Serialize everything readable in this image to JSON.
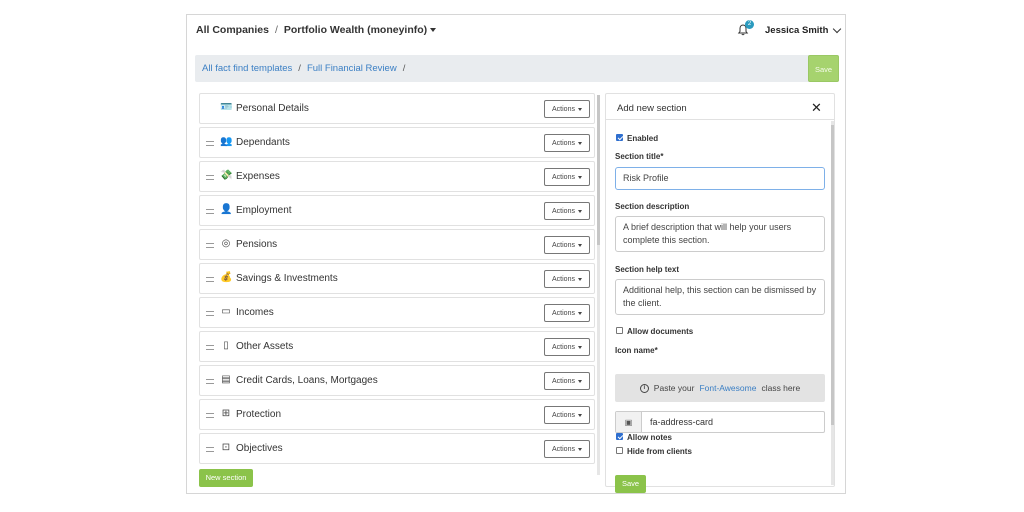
{
  "topbar": {
    "company": "All Companies",
    "separator": "/",
    "portfolio": "Portfolio Wealth (moneyinfo)",
    "notification_count": "2",
    "user_name": "Jessica Smith"
  },
  "breadcrumb": {
    "items": [
      "All fact find templates",
      "Full Financial Review"
    ],
    "separator": "/",
    "save_label": "Save"
  },
  "sections": [
    {
      "label": "Personal Details",
      "icon": "address-card-icon",
      "glyph": "🪪",
      "actions": "Actions"
    },
    {
      "label": "Dependants",
      "icon": "users-icon",
      "glyph": "👥",
      "actions": "Actions"
    },
    {
      "label": "Expenses",
      "icon": "money-bill-icon",
      "glyph": "💸",
      "actions": "Actions"
    },
    {
      "label": "Employment",
      "icon": "user-tie-icon",
      "glyph": "👤",
      "actions": "Actions"
    },
    {
      "label": "Pensions",
      "icon": "coins-icon",
      "glyph": "◎",
      "actions": "Actions"
    },
    {
      "label": "Savings & Investments",
      "icon": "money-bag-icon",
      "glyph": "💰",
      "actions": "Actions"
    },
    {
      "label": "Incomes",
      "icon": "wallet-icon",
      "glyph": "▭",
      "actions": "Actions"
    },
    {
      "label": "Other Assets",
      "icon": "building-icon",
      "glyph": "▯",
      "actions": "Actions"
    },
    {
      "label": "Credit Cards, Loans, Mortgages",
      "icon": "credit-card-icon",
      "glyph": "▤",
      "actions": "Actions"
    },
    {
      "label": "Protection",
      "icon": "shield-icon",
      "glyph": "⊞",
      "actions": "Actions"
    },
    {
      "label": "Objectives",
      "icon": "bullseye-icon",
      "glyph": "⊡",
      "actions": "Actions"
    }
  ],
  "new_section_label": "New section",
  "panel": {
    "title": "Add new section",
    "enabled_label": "Enabled",
    "enabled": true,
    "section_title_label": "Section title*",
    "section_title_value": "Risk Profile",
    "description_label": "Section description",
    "description_value": "A brief description that will help your users complete this section.",
    "help_label": "Section help text",
    "help_value": "Additional help, this section can be dismissed by the client.",
    "allow_documents_label": "Allow documents",
    "allow_documents": false,
    "icon_name_label": "Icon name*",
    "icon_hint_prefix": "Paste your",
    "icon_hint_link": "Font-Awesome",
    "icon_hint_suffix": "class here",
    "icon_value": "fa-address-card",
    "allow_notes_label": "Allow notes",
    "allow_notes": true,
    "hide_label": "Hide from clients",
    "hide": false,
    "save_label": "Save"
  },
  "colors": {
    "accent_green": "#8bc34a",
    "link_blue": "#3b7fc4",
    "badge": "#2b9bbf"
  }
}
